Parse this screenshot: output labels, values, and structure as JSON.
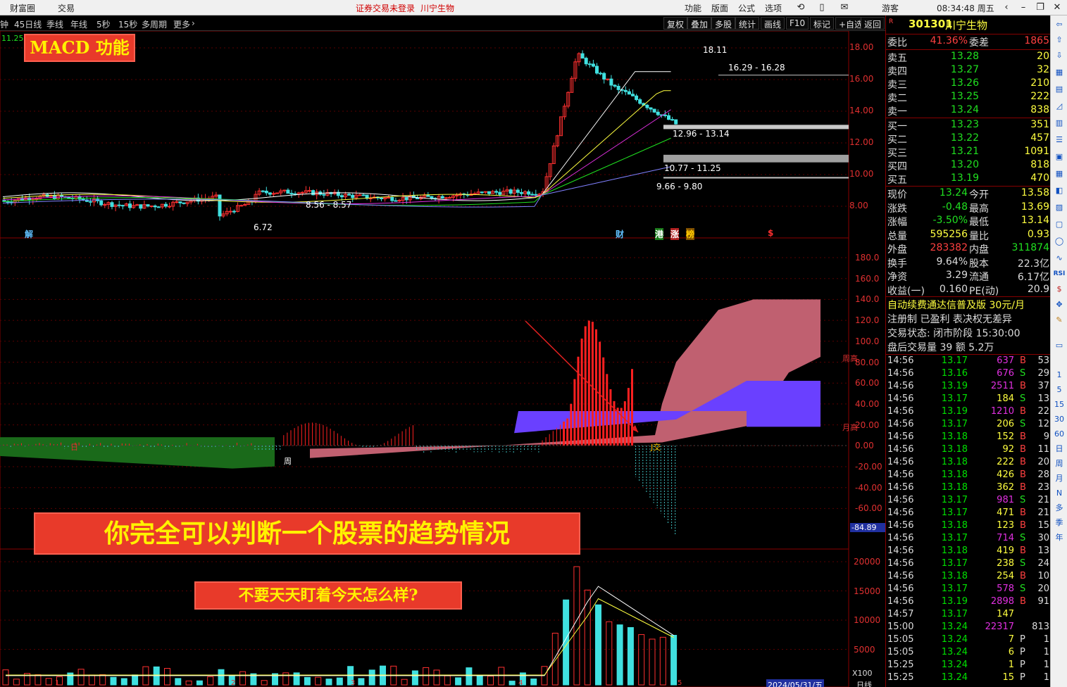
{
  "titlebar": {
    "menu_items": [
      "财富圈",
      "交易"
    ],
    "warning": "证券交易未登录",
    "stock_name": "川宁生物",
    "right_menu": [
      "功能",
      "版面",
      "公式",
      "选项"
    ],
    "guest": "游客",
    "clock": "08:34:48 周五"
  },
  "periodbar": {
    "periods": [
      "钟",
      "45日线",
      "季线",
      "年线",
      "5秒",
      "15秒",
      "多周期",
      "更多"
    ],
    "tools": [
      "复权",
      "叠加",
      "多股",
      "统计",
      "画线",
      "F10",
      "标记",
      "+自选",
      "返回"
    ]
  },
  "chart": {
    "top_left_value": "11.25",
    "price_axis": [
      "18.00",
      "16.00",
      "14.00",
      "12.00",
      "10.00",
      "8.00"
    ],
    "price_annotations": [
      "18.11",
      "16.29 - 16.28",
      "12.96 - 13.14",
      "10.77 - 11.25",
      "9.66 - 9.80",
      "8.56 - 8.57",
      "6.72"
    ],
    "event_markers": [
      "解",
      "财",
      "港",
      "涨",
      "榜",
      "$"
    ],
    "macd_axis": [
      "180.0",
      "160.0",
      "140.0",
      "120.0",
      "100.0",
      "80.00",
      "60.00",
      "40.00",
      "20.00",
      "0.00",
      "-20.00",
      "-40.00",
      "-60.00"
    ],
    "macd_labels": {
      "week_high": "周高",
      "month_high": "月高",
      "week": "周",
      "day": "日",
      "cross": "J交",
      "current": "-84.89"
    },
    "vol_axis": [
      "20000",
      "15000",
      "10000",
      "5000"
    ],
    "vol_unit": "X100",
    "date_label": "2024/05/31/五",
    "x_ticks": [
      "1",
      "2",
      "3",
      "4",
      "5"
    ],
    "bottom_right": "日线"
  },
  "banners": {
    "macd_title": "MACD 功能",
    "main_caption": "你完全可以判断一个股票的趋势情况",
    "sub_caption": "不要天天盯着今天怎么样?"
  },
  "quote": {
    "code": "301301",
    "name": "川宁生物",
    "weibi_label": "委比",
    "weibi": "41.36%",
    "weicha_label": "委差",
    "weicha": "1865",
    "asks": [
      {
        "label": "卖五",
        "price": "13.28",
        "vol": "20"
      },
      {
        "label": "卖四",
        "price": "13.27",
        "vol": "32"
      },
      {
        "label": "卖三",
        "price": "13.26",
        "vol": "210"
      },
      {
        "label": "卖二",
        "price": "13.25",
        "vol": "222"
      },
      {
        "label": "卖一",
        "price": "13.24",
        "vol": "838"
      }
    ],
    "bids": [
      {
        "label": "买一",
        "price": "13.23",
        "vol": "351"
      },
      {
        "label": "买二",
        "price": "13.22",
        "vol": "457"
      },
      {
        "label": "买三",
        "price": "13.21",
        "vol": "1091"
      },
      {
        "label": "买四",
        "price": "13.20",
        "vol": "818"
      },
      {
        "label": "买五",
        "price": "13.19",
        "vol": "470"
      }
    ],
    "stats": [
      {
        "l1": "现价",
        "v1": "13.24",
        "l2": "今开",
        "v2": "13.58"
      },
      {
        "l1": "涨跌",
        "v1": "-0.48",
        "l2": "最高",
        "v2": "13.69"
      },
      {
        "l1": "涨幅",
        "v1": "-3.50%",
        "l2": "最低",
        "v2": "13.14"
      },
      {
        "l1": "总量",
        "v1": "595256",
        "l2": "量比",
        "v2": "0.93"
      },
      {
        "l1": "外盘",
        "v1": "283382",
        "l2": "内盘",
        "v2": "311874"
      },
      {
        "l1": "换手",
        "v1": "9.64%",
        "l2": "股本",
        "v2": "22.3亿"
      },
      {
        "l1": "净资",
        "v1": "3.29",
        "l2": "流通",
        "v2": "6.17亿"
      },
      {
        "l1": "收益(一)",
        "v1": "0.160",
        "l2": "PE(动)",
        "v2": "20.9"
      }
    ],
    "ad1": "自动续费通达信普及版 30元/月",
    "ad2": "注册制 已盈利 表决权无差异",
    "state": "交易状态: 闭市阶段 15:30:00",
    "after": "盘后交易量 39 额 5.2万",
    "ticks": [
      [
        "14:56",
        "13.17",
        "637",
        "B",
        "53"
      ],
      [
        "14:56",
        "13.16",
        "676",
        "S",
        "29"
      ],
      [
        "14:56",
        "13.19",
        "2511",
        "B",
        "37"
      ],
      [
        "14:56",
        "13.17",
        "184",
        "S",
        "13"
      ],
      [
        "14:56",
        "13.19",
        "1210",
        "B",
        "22"
      ],
      [
        "14:56",
        "13.17",
        "206",
        "S",
        "12"
      ],
      [
        "14:56",
        "13.18",
        "152",
        "B",
        "9"
      ],
      [
        "14:56",
        "13.18",
        "92",
        "B",
        "11"
      ],
      [
        "14:56",
        "13.18",
        "222",
        "B",
        "20"
      ],
      [
        "14:56",
        "13.18",
        "426",
        "B",
        "28"
      ],
      [
        "14:56",
        "13.18",
        "362",
        "B",
        "23"
      ],
      [
        "14:56",
        "13.17",
        "981",
        "S",
        "21"
      ],
      [
        "14:56",
        "13.17",
        "471",
        "B",
        "21"
      ],
      [
        "14:56",
        "13.18",
        "123",
        "B",
        "15"
      ],
      [
        "14:56",
        "13.17",
        "714",
        "S",
        "30"
      ],
      [
        "14:56",
        "13.18",
        "419",
        "B",
        "13"
      ],
      [
        "14:56",
        "13.17",
        "238",
        "S",
        "24"
      ],
      [
        "14:56",
        "13.18",
        "254",
        "B",
        "10"
      ],
      [
        "14:56",
        "13.17",
        "578",
        "S",
        "20"
      ],
      [
        "14:56",
        "13.19",
        "2898",
        "B",
        "91"
      ],
      [
        "14:57",
        "13.17",
        "147",
        "",
        ""
      ],
      [
        "15:00",
        "13.24",
        "22317",
        "",
        "813"
      ],
      [
        "15:05",
        "13.24",
        "7",
        "P",
        "1"
      ],
      [
        "15:05",
        "13.24",
        "6",
        "P",
        "1"
      ],
      [
        "15:25",
        "13.24",
        "1",
        "P",
        "1"
      ],
      [
        "15:25",
        "13.24",
        "15",
        "P",
        "1"
      ]
    ]
  },
  "rightbar": [
    "1",
    "5",
    "15",
    "30",
    "60",
    "日",
    "周",
    "月",
    "N",
    "多",
    "季",
    "年"
  ]
}
